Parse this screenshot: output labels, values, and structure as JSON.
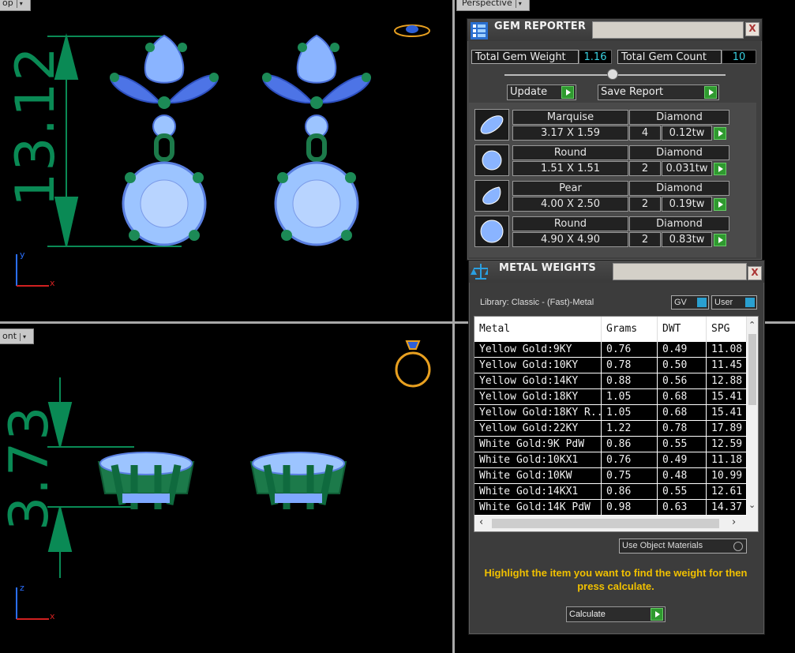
{
  "viewports": {
    "top": {
      "label": "op"
    },
    "perspective": {
      "label": "Perspective"
    },
    "front": {
      "label": "ont"
    }
  },
  "dimensions": {
    "top_value": "13.12",
    "front_value": "3.73"
  },
  "axes": {
    "y": "y",
    "x": "x",
    "z": "z"
  },
  "gem_reporter": {
    "title": "GEM REPORTER",
    "close": "X",
    "total_weight_label": "Total Gem Weight",
    "total_weight_value": "1.16",
    "total_count_label": "Total Gem Count",
    "total_count_value": "10",
    "update_label": "Update",
    "save_report_label": "Save Report",
    "gems": [
      {
        "shape": "Marquise",
        "size": "3.17 X 1.59",
        "material": "Diamond",
        "count": "4",
        "weight": "0.12tw"
      },
      {
        "shape": "Round",
        "size": "1.51 X 1.51",
        "material": "Diamond",
        "count": "2",
        "weight": "0.031tw"
      },
      {
        "shape": "Pear",
        "size": "4.00 X 2.50",
        "material": "Diamond",
        "count": "2",
        "weight": "0.19tw"
      },
      {
        "shape": "Round",
        "size": "4.90 X 4.90",
        "material": "Diamond",
        "count": "2",
        "weight": "0.83tw"
      }
    ]
  },
  "metal_weights": {
    "title": "METAL WEIGHTS",
    "close": "X",
    "library_label": "Library: Classic - (Fast)-Metal",
    "gv_label": "GV",
    "user_label": "User",
    "columns": [
      "Metal",
      "Grams",
      "DWT",
      "SPG"
    ],
    "rows": [
      [
        "Yellow Gold:9KY",
        "0.76",
        "0.49",
        "11.08"
      ],
      [
        "Yellow Gold:10KY",
        "0.78",
        "0.50",
        "11.45"
      ],
      [
        "Yellow Gold:14KY",
        "0.88",
        "0.56",
        "12.88"
      ],
      [
        "Yellow Gold:18KY",
        "1.05",
        "0.68",
        "15.41"
      ],
      [
        "Yellow Gold:18KY R...",
        "1.05",
        "0.68",
        "15.41"
      ],
      [
        "Yellow Gold:22KY",
        "1.22",
        "0.78",
        "17.89"
      ],
      [
        "White Gold:9K PdW",
        "0.86",
        "0.55",
        "12.59"
      ],
      [
        "White Gold:10KX1",
        "0.76",
        "0.49",
        "11.18"
      ],
      [
        "White Gold:10KW",
        "0.75",
        "0.48",
        "10.99"
      ],
      [
        "White Gold:14KX1",
        "0.86",
        "0.55",
        "12.61"
      ],
      [
        "White Gold:14K PdW",
        "0.98",
        "0.63",
        "14.37"
      ]
    ],
    "use_object_materials_label": "Use Object Materials",
    "instruction": "Highlight the item you want to find the weight for then press calculate.",
    "calculate_label": "Calculate",
    "colors": {
      "instruction": "#f0c000",
      "accent": "#2aa0d0",
      "go": "#2f9a2f"
    }
  }
}
